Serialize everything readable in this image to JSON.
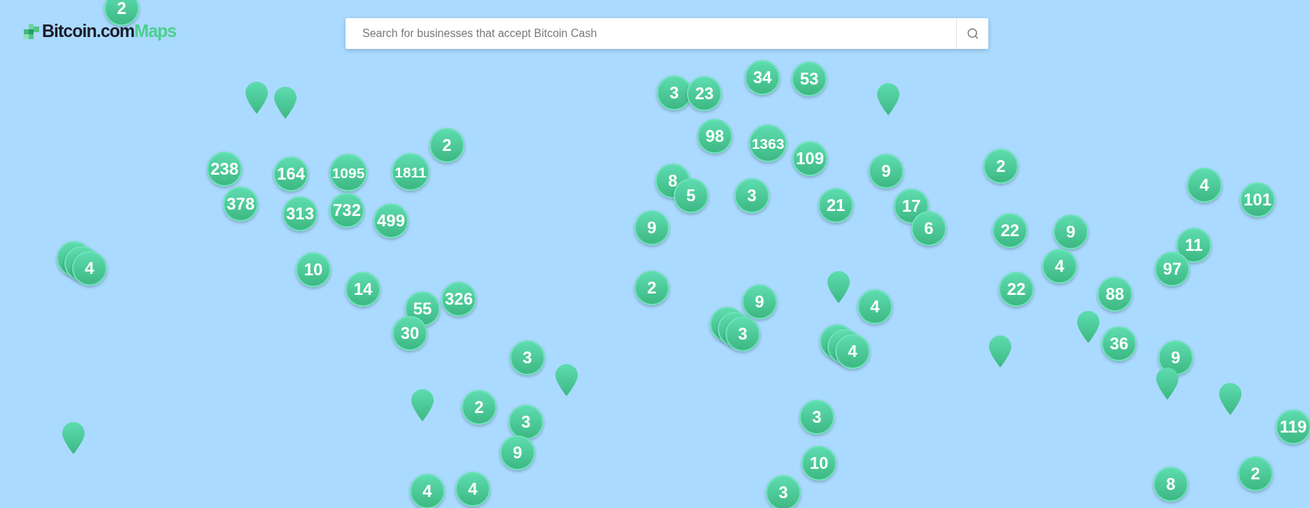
{
  "logo": {
    "brand": "Bitcoin.com",
    "product": "Maps"
  },
  "search": {
    "placeholder": "Search for businesses that accept Bitcoin Cash"
  },
  "markers": [
    {
      "kind": "cluster",
      "count": "2",
      "stacked": false
    },
    {
      "kind": "pin"
    },
    {
      "kind": "pin"
    },
    {
      "kind": "cluster",
      "count": "238",
      "stacked": false
    },
    {
      "kind": "cluster",
      "count": "164",
      "stacked": false
    },
    {
      "kind": "cluster",
      "count": "1095",
      "stacked": false
    },
    {
      "kind": "cluster",
      "count": "1811",
      "stacked": false
    },
    {
      "kind": "cluster",
      "count": "2",
      "stacked": false
    },
    {
      "kind": "cluster",
      "count": "378",
      "stacked": false
    },
    {
      "kind": "cluster",
      "count": "313",
      "stacked": false
    },
    {
      "kind": "cluster",
      "count": "732",
      "stacked": false
    },
    {
      "kind": "cluster",
      "count": "499",
      "stacked": false
    },
    {
      "kind": "cluster",
      "count": "4",
      "stacked": true
    },
    {
      "kind": "cluster",
      "count": "10",
      "stacked": false
    },
    {
      "kind": "cluster",
      "count": "14",
      "stacked": false
    },
    {
      "kind": "cluster",
      "count": "326",
      "stacked": false
    },
    {
      "kind": "cluster",
      "count": "55",
      "stacked": false
    },
    {
      "kind": "cluster",
      "count": "30",
      "stacked": false
    },
    {
      "kind": "cluster",
      "count": "3",
      "stacked": false
    },
    {
      "kind": "pin"
    },
    {
      "kind": "pin"
    },
    {
      "kind": "cluster",
      "count": "2",
      "stacked": false
    },
    {
      "kind": "cluster",
      "count": "3",
      "stacked": false
    },
    {
      "kind": "cluster",
      "count": "9",
      "stacked": false
    },
    {
      "kind": "pin"
    },
    {
      "kind": "cluster",
      "count": "4",
      "stacked": false
    },
    {
      "kind": "cluster",
      "count": "4",
      "stacked": false
    },
    {
      "kind": "cluster",
      "count": "3",
      "stacked": false
    },
    {
      "kind": "cluster",
      "count": "23",
      "stacked": false
    },
    {
      "kind": "cluster",
      "count": "34",
      "stacked": false
    },
    {
      "kind": "cluster",
      "count": "53",
      "stacked": false
    },
    {
      "kind": "pin"
    },
    {
      "kind": "cluster",
      "count": "98",
      "stacked": false
    },
    {
      "kind": "cluster",
      "count": "1363",
      "stacked": false
    },
    {
      "kind": "cluster",
      "count": "109",
      "stacked": false
    },
    {
      "kind": "cluster",
      "count": "9",
      "stacked": false
    },
    {
      "kind": "cluster",
      "count": "8",
      "stacked": false
    },
    {
      "kind": "cluster",
      "count": "5",
      "stacked": false
    },
    {
      "kind": "cluster",
      "count": "3",
      "stacked": false
    },
    {
      "kind": "cluster",
      "count": "21",
      "stacked": false
    },
    {
      "kind": "cluster",
      "count": "17",
      "stacked": false
    },
    {
      "kind": "cluster",
      "count": "9",
      "stacked": false
    },
    {
      "kind": "cluster",
      "count": "6",
      "stacked": false
    },
    {
      "kind": "cluster",
      "count": "2",
      "stacked": false
    },
    {
      "kind": "cluster",
      "count": "9",
      "stacked": false
    },
    {
      "kind": "cluster",
      "count": "3",
      "stacked": true
    },
    {
      "kind": "pin"
    },
    {
      "kind": "cluster",
      "count": "4",
      "stacked": false
    },
    {
      "kind": "cluster",
      "count": "4",
      "stacked": true
    },
    {
      "kind": "cluster",
      "count": "3",
      "stacked": false
    },
    {
      "kind": "cluster",
      "count": "10",
      "stacked": false
    },
    {
      "kind": "cluster",
      "count": "3",
      "stacked": false
    },
    {
      "kind": "cluster",
      "count": "2",
      "stacked": false
    },
    {
      "kind": "cluster",
      "count": "4",
      "stacked": false
    },
    {
      "kind": "cluster",
      "count": "101",
      "stacked": false
    },
    {
      "kind": "cluster",
      "count": "22",
      "stacked": false
    },
    {
      "kind": "cluster",
      "count": "9",
      "stacked": false
    },
    {
      "kind": "cluster",
      "count": "4",
      "stacked": false
    },
    {
      "kind": "cluster",
      "count": "11",
      "stacked": false
    },
    {
      "kind": "cluster",
      "count": "97",
      "stacked": false
    },
    {
      "kind": "cluster",
      "count": "22",
      "stacked": false
    },
    {
      "kind": "cluster",
      "count": "88",
      "stacked": false
    },
    {
      "kind": "pin"
    },
    {
      "kind": "pin"
    },
    {
      "kind": "cluster",
      "count": "36",
      "stacked": false
    },
    {
      "kind": "cluster",
      "count": "9",
      "stacked": false
    },
    {
      "kind": "pin"
    },
    {
      "kind": "pin"
    },
    {
      "kind": "cluster",
      "count": "119",
      "stacked": false
    },
    {
      "kind": "cluster",
      "count": "8",
      "stacked": false
    },
    {
      "kind": "cluster",
      "count": "2",
      "stacked": false
    }
  ]
}
